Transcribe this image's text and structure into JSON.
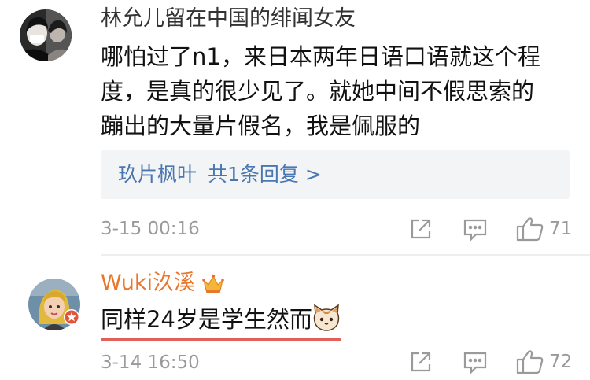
{
  "comments": [
    {
      "username": "林允儿留在中国的绯闻女友",
      "lines": [
        "哪怕过了n1，来日本两年日语口语就这个程",
        "度，是真的很少见了。就她中间不假思索的",
        "蹦出的大量片假名，我是佩服的"
      ],
      "reply_user": "玖片枫叶",
      "reply_count": "共1条回复 >",
      "timestamp": "3-15 00:16",
      "likes": "71"
    },
    {
      "username": "Wuki汣溪",
      "text": "同样24岁是学生然而",
      "timestamp": "3-14 16:50",
      "likes": "72"
    }
  ],
  "icons": {
    "share": "share-icon",
    "comment": "comment-icon",
    "like": "thumbs-up-icon",
    "crown": "crown-icon",
    "emoji": "cat-emoji-icon",
    "verified": "verified-badge-icon"
  },
  "colors": {
    "link_blue": "#4a77b0",
    "vip_orange": "#e8762b",
    "underline_red": "#e2605a",
    "meta_gray": "#9a9a9a"
  }
}
